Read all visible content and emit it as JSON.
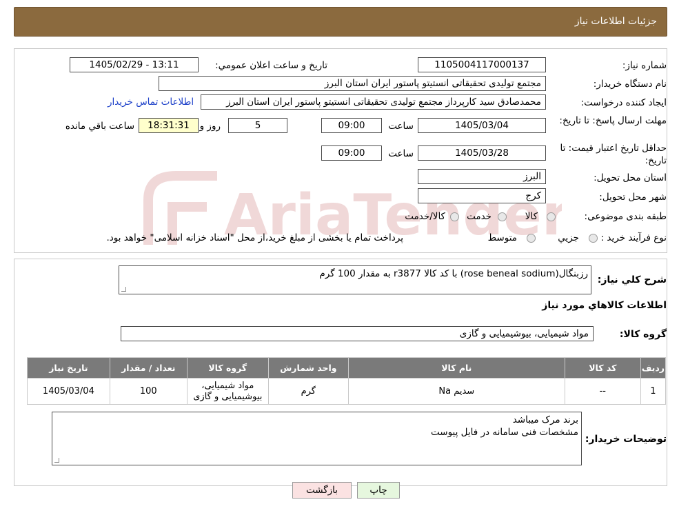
{
  "header": {
    "title": "جزئیات اطلاعات نیاز"
  },
  "form": {
    "need_number_label": "شماره نیاز:",
    "need_number": "1105004117000137",
    "announce_label": "تاريخ و ساعت اعلان عمومي:",
    "announce_value": "1405/02/29 - 13:11",
    "buyer_org_label": "نام دستگاه خريدار:",
    "buyer_org": "مجتمع تولیدی تحقیقاتی انستیتو پاستور ایران استان البرز",
    "creator_label": "ايجاد کننده درخواست:",
    "creator": "محمدصادق سید کارپرداز مجتمع تولیدی تحقیقاتی انستیتو پاستور ایران استان البرز",
    "contact_link": "اطلاعات تماس خريدار",
    "reply_deadline_label": "مهلت ارسال پاسخ: تا تاريخ:",
    "reply_date": "1405/03/04",
    "time_label": "ساعت",
    "reply_time": "09:00",
    "days": "5",
    "days_label": "روز و",
    "remaining_time": "18:31:31",
    "remaining_label": "ساعت باقي مانده",
    "price_valid_label": "حداقل تاريخ اعتبار قيمت: تا تاريخ:",
    "price_valid_date": "1405/03/28",
    "price_valid_time": "09:00",
    "province_label": "استان محل تحويل:",
    "province": "البرز",
    "city_label": "شهر محل تحويل:",
    "city": "کرج",
    "category_label": "طبقه بندی موضوعی:",
    "category_options": [
      "کالا",
      "خدمت",
      "کالا/خدمت"
    ],
    "process_label": "نوع فرآيند خريد :",
    "process_options": [
      "جزيي",
      "متوسط"
    ],
    "process_note": "پرداخت تمام یا بخشی از مبلغ خرید،از محل \"اسناد خزانه اسلامی\" خواهد بود."
  },
  "summary": {
    "desc_label": "شرح کلي نياز:",
    "desc_value": "رزبنگال(rose beneal sodium) با کد کالا r3877  به مقدار 100 گرم",
    "items_title": "اطلاعات کالاهاي مورد نياز",
    "group_label": "گروه کالا:",
    "group_value": "مواد شیمیایی، بیوشیمیایی و  گازی"
  },
  "table": {
    "headers": [
      "رديف",
      "کد کالا",
      "نام کالا",
      "واحد شمارش",
      "گروه کالا",
      "تعداد / مقدار",
      "تاريخ نياز"
    ],
    "rows": [
      [
        "1",
        "--",
        "سدیم Na",
        "گرم",
        "مواد شیمیایی، بیوشیمیایی و گازی",
        "100",
        "1405/03/04"
      ]
    ]
  },
  "buyer_notes": {
    "label": "توضيحات خريدار:",
    "line1": "برند مرک میباشد",
    "line2": "مشخصات فنی سامانه در فایل پیوست"
  },
  "buttons": {
    "print": "چاپ",
    "back": "بازگشت"
  },
  "watermark": {
    "text": "AriaTender.neT"
  },
  "colors": {
    "header": "#8b6a3e",
    "table_header": "#7a7a7a",
    "link": "#1a3ec8",
    "back_button": "#fbe2e2",
    "print_button": "#e6f7de",
    "remaining_box": "#ffffcc"
  }
}
